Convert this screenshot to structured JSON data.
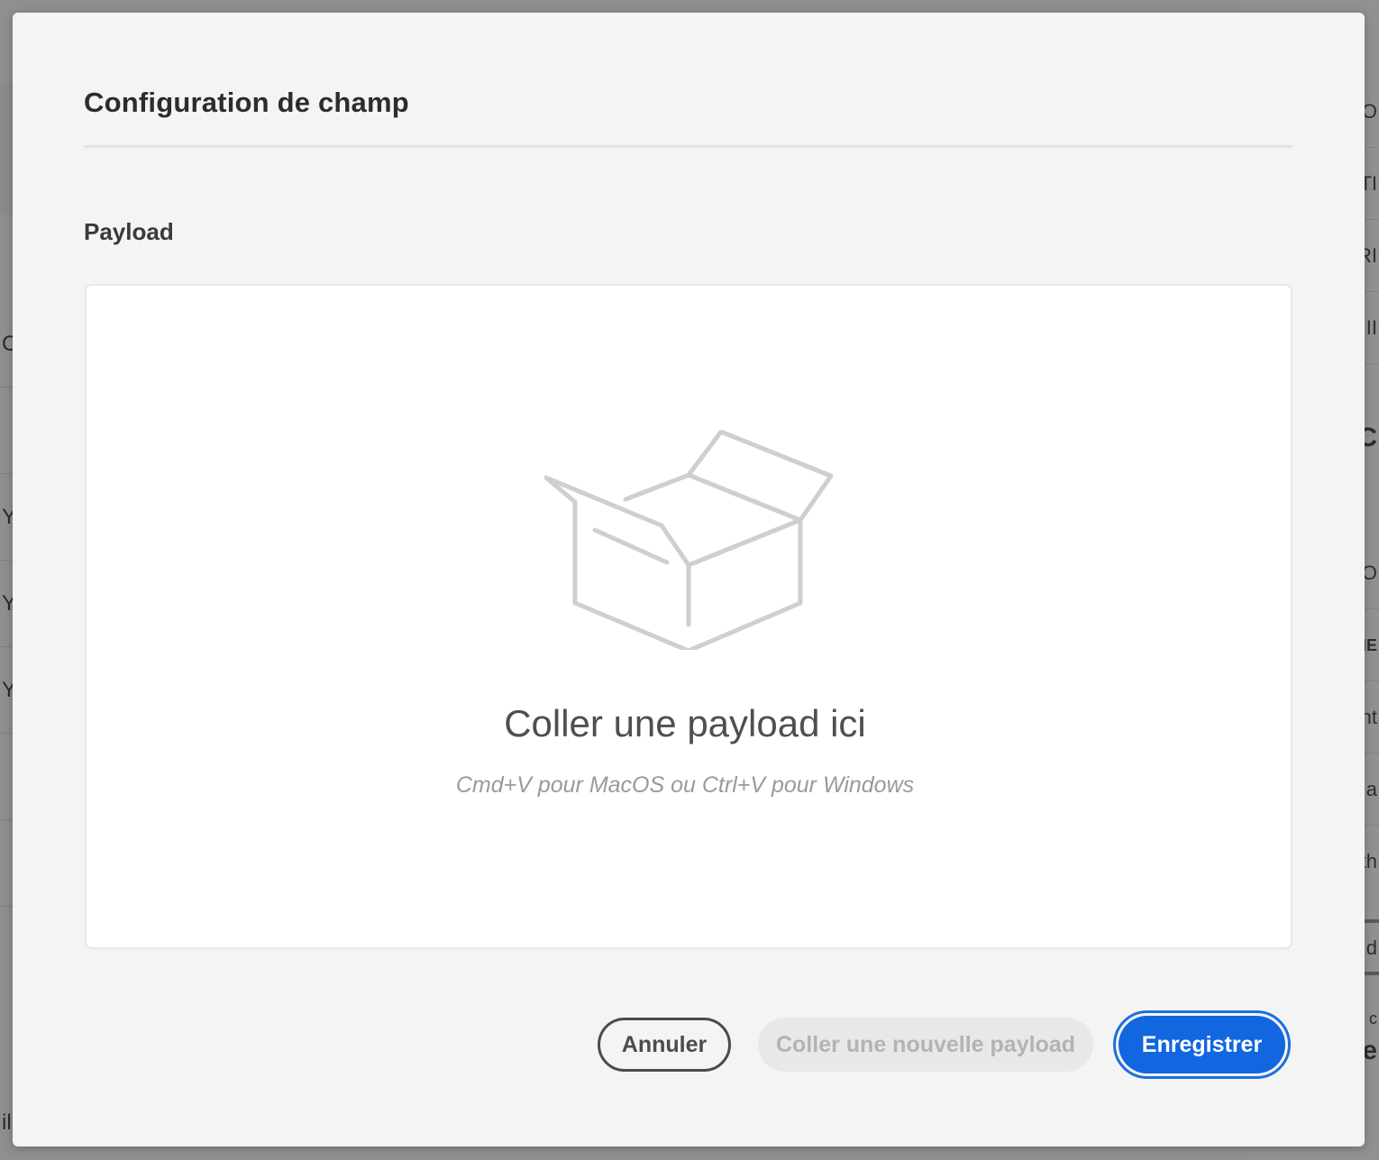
{
  "background": {
    "left_rows": [
      "C",
      "",
      "YP",
      "YP",
      "YP",
      "",
      "",
      "il"
    ],
    "right_rows": [
      "O",
      "TI",
      "RI",
      "II",
      "",
      "C",
      "O",
      "HE",
      "nt",
      "a",
      "th",
      "d",
      "c",
      "e"
    ]
  },
  "dialog": {
    "title": "Configuration de champ",
    "section_label": "Payload",
    "drop_zone": {
      "icon": "open-box-icon",
      "title": "Coller une payload ici",
      "hint": "Cmd+V pour MacOS ou Ctrl+V pour Windows"
    },
    "buttons": {
      "cancel": "Annuler",
      "paste_new": "Coller une nouvelle payload",
      "save": "Enregistrer"
    }
  },
  "colors": {
    "accent": "#1266e0",
    "icon_stroke": "#cfcfcf",
    "disabled_text": "#b3b3b3"
  }
}
